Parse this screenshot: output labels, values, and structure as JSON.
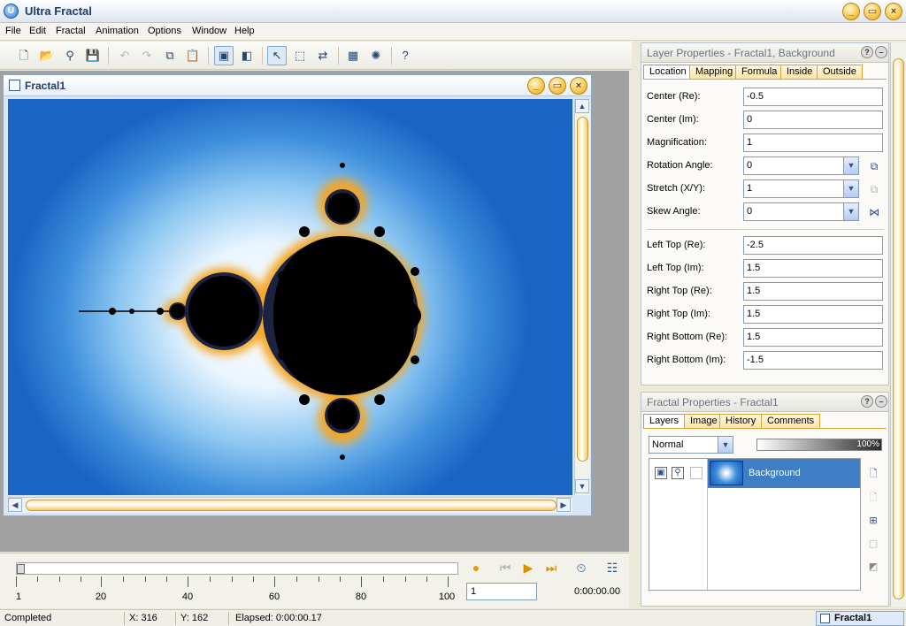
{
  "app": {
    "title": "Ultra Fractal",
    "icon": "app-logo-icon"
  },
  "window_buttons": [
    "_",
    "▭",
    "×"
  ],
  "menu": [
    "File",
    "Edit",
    "Fractal",
    "Animation",
    "Options",
    "Window",
    "Help"
  ],
  "toolbar": {
    "icons": [
      "new-icon",
      "open-icon",
      "browse-icon",
      "save-icon",
      "undo-icon",
      "redo-icon",
      "copy-icon",
      "paste-icon",
      "fractal-mode-icon",
      "layer-mode-icon",
      "select-icon",
      "zoom-box-icon",
      "switch-icon",
      "render-icon",
      "explore-icon",
      "help-icon"
    ],
    "help_label": "?"
  },
  "document": {
    "title": "Fractal1",
    "scroll_arrows": {
      "up": "▲",
      "down": "▼",
      "left": "◀",
      "right": "▶"
    }
  },
  "layer_properties": {
    "title": "Layer Properties - Fractal1, Background",
    "help": "?",
    "tabs": [
      "Location",
      "Mapping",
      "Formula",
      "Inside",
      "Outside"
    ],
    "selected_tab": "Location",
    "fields": [
      {
        "label": "Center (Re):",
        "value": "-0.5"
      },
      {
        "label": "Center (Im):",
        "value": "0"
      },
      {
        "label": "Magnification:",
        "value": "1"
      },
      {
        "label": "Rotation Angle:",
        "value": "0"
      },
      {
        "label": "Stretch (X/Y):",
        "value": "1"
      },
      {
        "label": "Skew Angle:",
        "value": "0"
      }
    ],
    "corner_fields": [
      {
        "label": "Left Top (Re):",
        "value": "-2.5"
      },
      {
        "label": "Left Top (Im):",
        "value": "1.5"
      },
      {
        "label": "Right Top (Re):",
        "value": "1.5"
      },
      {
        "label": "Right Top (Im):",
        "value": "1.5"
      },
      {
        "label": "Right Bottom (Re):",
        "value": "1.5"
      },
      {
        "label": "Right Bottom (Im):",
        "value": "-1.5"
      }
    ]
  },
  "fractal_properties": {
    "title": "Fractal Properties - Fractal1",
    "help": "?",
    "tabs": [
      "Layers",
      "Image",
      "History",
      "Comments"
    ],
    "selected_tab": "Layers",
    "blend_mode": "Normal",
    "opacity": "100%",
    "layers": [
      {
        "name": "Background"
      }
    ]
  },
  "timeline": {
    "labels": [
      "1",
      "20",
      "40",
      "60",
      "80",
      "100"
    ],
    "frame": "1",
    "time": "0:00:00.00"
  },
  "status": {
    "state": "Completed",
    "x": "X: 316",
    "y": "Y: 162",
    "elapsed": "Elapsed: 0:00:00.17",
    "active_document": "Fractal1"
  },
  "colors": {
    "accent": "#3f7dc4",
    "tab_orange": "#fbe2a4",
    "title_text": "#1e3c6e"
  }
}
